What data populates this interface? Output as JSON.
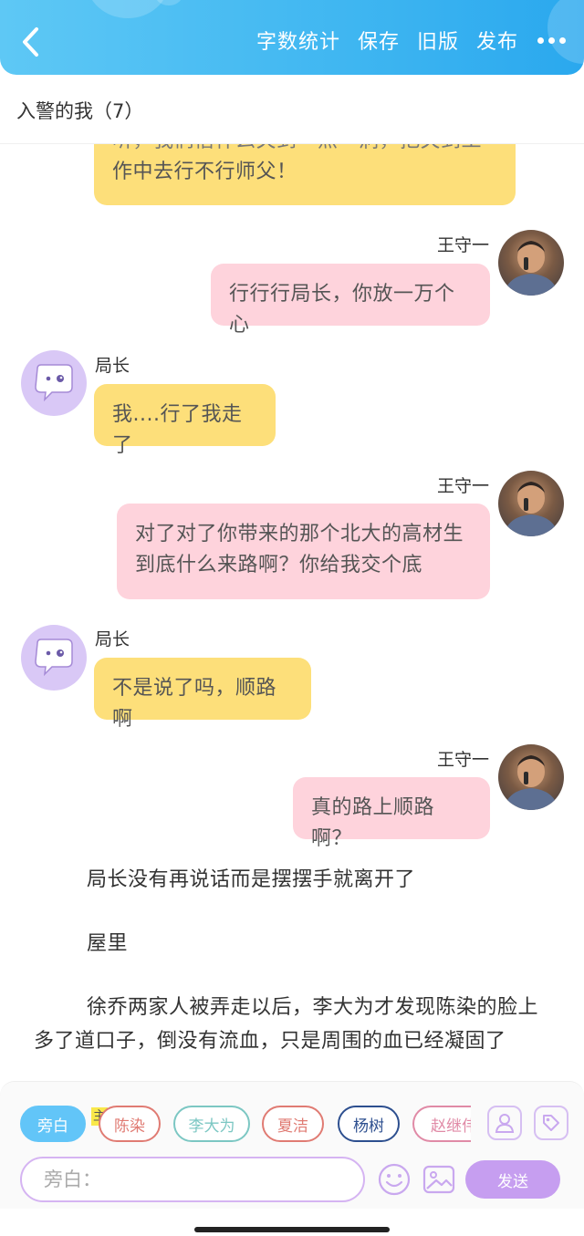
{
  "header": {
    "actions": [
      "字数统计",
      "保存",
      "旧版",
      "发布"
    ]
  },
  "doc_title": "入警的我（7）",
  "messages": [
    {
      "side": "left",
      "text_lines": [
        "听，我们借什么关到一点一洞，把关到工",
        "作中去行不行师父！"
      ]
    },
    {
      "side": "right",
      "name": "王守一",
      "text": "行行行局长，你放一万个心"
    },
    {
      "side": "left",
      "name": "局长",
      "text": "我....行了我走了"
    },
    {
      "side": "right",
      "name": "王守一",
      "text_lines": [
        "对了对了你带来的那个北大的高材生",
        "到底什么来路啊？你给我交个底"
      ]
    },
    {
      "side": "left",
      "name": "局长",
      "text": "不是说了吗，顺路啊"
    },
    {
      "side": "right",
      "name": "王守一",
      "text": "真的路上顺路啊？"
    }
  ],
  "narration": [
    "局长没有再说话而是摆摆手就离开了",
    "屋里",
    "徐乔两家人被弄走以后，李大为才发现陈染的脸上",
    "多了道口子，倒没有流血，只是周围的血已经凝固了"
  ],
  "characters": [
    {
      "label": "旁白",
      "color": "#62c5f8"
    },
    {
      "label": "陈染",
      "color": "#e07b73"
    },
    {
      "label": "李大为",
      "color": "#7cc7c3"
    },
    {
      "label": "夏洁",
      "color": "#e07b73"
    },
    {
      "label": "杨树",
      "color": "#2d4f8f"
    },
    {
      "label": "赵继伟",
      "color": "#e08aa6"
    }
  ],
  "main_badge": "主",
  "input": {
    "placeholder": "旁白："
  },
  "send_label": "发送",
  "colors": {
    "header_blue": "#3fb6f1",
    "left_bubble": "#fddf7a",
    "right_bubble": "#fed3dc",
    "accent_purple": "#c69ef0"
  }
}
